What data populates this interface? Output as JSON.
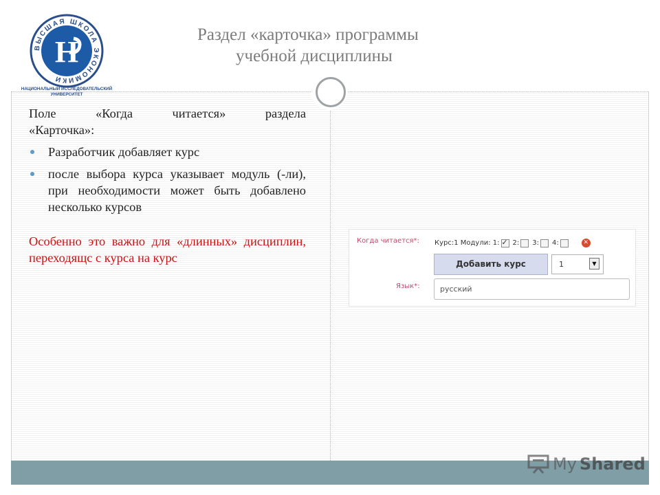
{
  "slide": {
    "title_line1": "Раздел «карточка» программы",
    "title_line2": "учебной дисциплины"
  },
  "logo": {
    "ring_text": "ВЫСШАЯ ШКОЛА ЭКОНОМИКИ",
    "caption_line1": "НАЦИОНАЛЬНЫЙ ИССЛЕДОВАТЕЛЬСКИЙ",
    "caption_line2": "УНИВЕРСИТЕТ"
  },
  "content": {
    "intro_line1": [
      "Поле",
      "«Когда",
      "читается»",
      "раздела"
    ],
    "intro_line2": "«Карточка»:",
    "bullets": [
      "Разработчик добавляет курс",
      "после выбора курса указывает модуль (-ли), при необходимости может быть добавлено несколько курсов"
    ],
    "note": "Особенно это важно для «длинных» дисциплин, переходящс с курса на курс"
  },
  "form": {
    "when_label": "Когда читается*:",
    "course_text": "Курс:1 Модули: 1:",
    "modules": [
      {
        "label": "",
        "checked": true
      },
      {
        "label": "2:",
        "checked": false
      },
      {
        "label": "3:",
        "checked": false
      },
      {
        "label": "4:",
        "checked": false
      }
    ],
    "add_button": "Добавить курс",
    "select_value": "1",
    "lang_label": "Язык*:",
    "lang_value": "русский"
  },
  "watermark": {
    "brand_regular": "My",
    "brand_bold": "Shared"
  },
  "colors": {
    "title": "#7b7b7b",
    "note": "#cc1111",
    "bullet": "#5c9dc8",
    "footer": "#7f9ea6",
    "form_label": "#c0476a"
  }
}
